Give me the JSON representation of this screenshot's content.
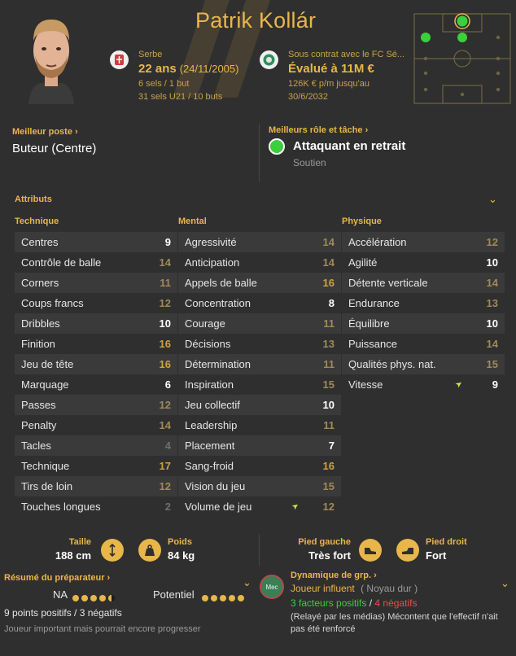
{
  "player": {
    "name": "Patrik Kollár",
    "nationality": "Serbe",
    "age": "22 ans",
    "dob": "(24/11/2005)",
    "caps": "6 sels / 1 but",
    "u21_caps": "31 sels U21 / 10 buts",
    "contract": "Sous contrat avec le FC Sé...",
    "value": "Évalué à 11M €",
    "wage": "126K € p/m jusqu'au",
    "contract_end": "30/6/2032"
  },
  "best_position": {
    "label": "Meilleur poste",
    "value": "Buteur (Centre)"
  },
  "best_role": {
    "label": "Meilleurs rôle et tâche",
    "value": "Attaquant en retrait",
    "duty": "Soutien"
  },
  "attributes": {
    "title": "Attributs",
    "technical": {
      "title": "Technique",
      "rows": [
        {
          "name": "Centres",
          "value": "9",
          "tone": "white"
        },
        {
          "name": "Contrôle de balle",
          "value": "14",
          "tone": "mid"
        },
        {
          "name": "Corners",
          "value": "11",
          "tone": "mid"
        },
        {
          "name": "Coups francs",
          "value": "12",
          "tone": "mid"
        },
        {
          "name": "Dribbles",
          "value": "10",
          "tone": "white"
        },
        {
          "name": "Finition",
          "value": "16",
          "tone": "good"
        },
        {
          "name": "Jeu de tête",
          "value": "16",
          "tone": "good"
        },
        {
          "name": "Marquage",
          "value": "6",
          "tone": "white"
        },
        {
          "name": "Passes",
          "value": "12",
          "tone": "mid"
        },
        {
          "name": "Penalty",
          "value": "14",
          "tone": "mid"
        },
        {
          "name": "Tacles",
          "value": "4",
          "tone": "dim"
        },
        {
          "name": "Technique",
          "value": "17",
          "tone": "good"
        },
        {
          "name": "Tirs de loin",
          "value": "12",
          "tone": "mid"
        },
        {
          "name": "Touches longues",
          "value": "2",
          "tone": "dim"
        }
      ]
    },
    "mental": {
      "title": "Mental",
      "rows": [
        {
          "name": "Agressivité",
          "value": "14",
          "tone": "mid"
        },
        {
          "name": "Anticipation",
          "value": "14",
          "tone": "mid"
        },
        {
          "name": "Appels de balle",
          "value": "16",
          "tone": "good"
        },
        {
          "name": "Concentration",
          "value": "8",
          "tone": "white"
        },
        {
          "name": "Courage",
          "value": "11",
          "tone": "mid"
        },
        {
          "name": "Décisions",
          "value": "13",
          "tone": "mid"
        },
        {
          "name": "Détermination",
          "value": "11",
          "tone": "mid"
        },
        {
          "name": "Inspiration",
          "value": "15",
          "tone": "mid"
        },
        {
          "name": "Jeu collectif",
          "value": "10",
          "tone": "white"
        },
        {
          "name": "Leadership",
          "value": "11",
          "tone": "mid"
        },
        {
          "name": "Placement",
          "value": "7",
          "tone": "white"
        },
        {
          "name": "Sang-froid",
          "value": "16",
          "tone": "good"
        },
        {
          "name": "Vision du jeu",
          "value": "15",
          "tone": "mid"
        },
        {
          "name": "Volume de jeu",
          "value": "12",
          "tone": "mid",
          "trend": "up"
        }
      ]
    },
    "physical": {
      "title": "Physique",
      "rows": [
        {
          "name": "Accélération",
          "value": "12",
          "tone": "mid"
        },
        {
          "name": "Agilité",
          "value": "10",
          "tone": "white"
        },
        {
          "name": "Détente verticale",
          "value": "14",
          "tone": "mid"
        },
        {
          "name": "Endurance",
          "value": "13",
          "tone": "mid"
        },
        {
          "name": "Équilibre",
          "value": "10",
          "tone": "white"
        },
        {
          "name": "Puissance",
          "value": "14",
          "tone": "mid"
        },
        {
          "name": "Qualités phys. nat.",
          "value": "15",
          "tone": "mid"
        },
        {
          "name": "Vitesse",
          "value": "9",
          "tone": "white",
          "trend": "up"
        }
      ]
    }
  },
  "physique": {
    "height_label": "Taille",
    "height": "188 cm",
    "weight_label": "Poids",
    "weight": "84 kg",
    "left_foot_label": "Pied gauche",
    "left_foot": "Très fort",
    "right_foot_label": "Pied droit",
    "right_foot": "Fort"
  },
  "coach_report": {
    "label": "Résumé du préparateur",
    "ca_label": "NA",
    "ca_stars": 4.5,
    "pa_label": "Potentiel",
    "pa_stars": 5,
    "summary": "9 points positifs / 3 négatifs",
    "note": "Joueur important mais pourrait encore progresser"
  },
  "dynamics": {
    "label": "Dynamique de grp.",
    "badge": "Mec",
    "status": "Joueur influent",
    "group": "( Noyau dur )",
    "positives": "3 facteurs positifs",
    "separator": "/",
    "negatives": "4 négatifs",
    "note": "(Relayé par les médias) Mécontent que l'effectif n'ait pas été renforcé"
  },
  "colors": {
    "accent": "#e8b64b",
    "background": "#2f2f2f",
    "positive": "#3ccf3c",
    "negative": "#ef4b4b"
  }
}
